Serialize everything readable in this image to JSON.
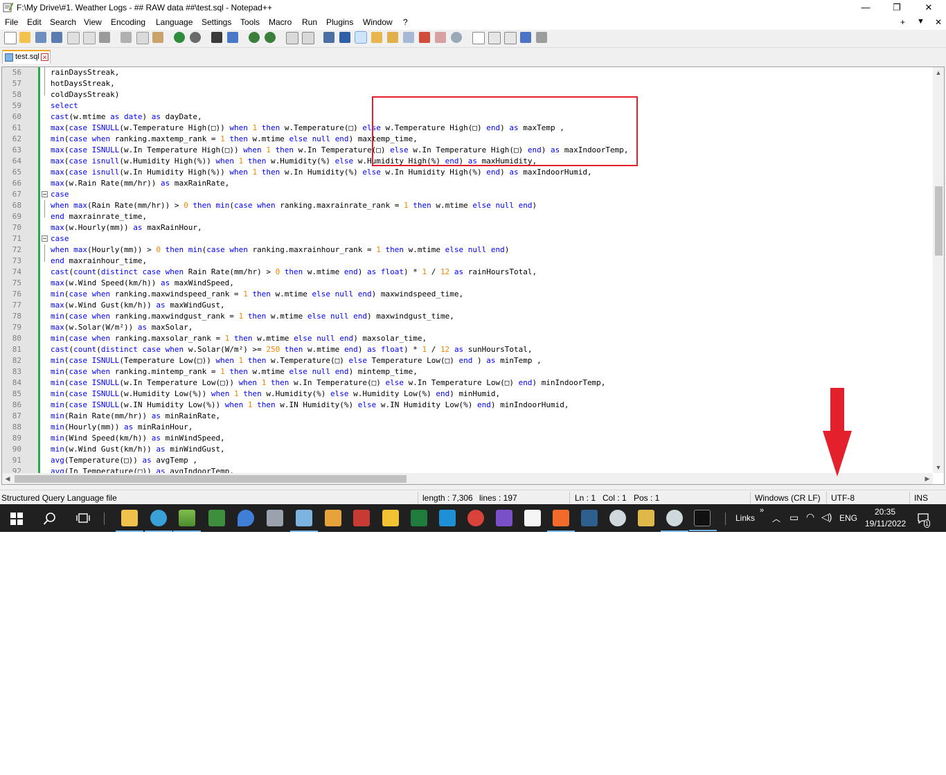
{
  "window": {
    "title": "F:\\My Drive\\#1. Weather Logs - ## RAW data ##\\test.sql - Notepad++",
    "minimize": "—",
    "maximize": "❐",
    "close": "✕"
  },
  "menu": {
    "items": [
      "File",
      "Edit",
      "Search",
      "View",
      "Encoding",
      "Language",
      "Settings",
      "Tools",
      "Macro",
      "Run",
      "Plugins",
      "Window",
      "?"
    ],
    "right": [
      "+",
      "▼",
      "✕"
    ]
  },
  "toolbar": {
    "buttons": [
      "new-file",
      "open-file",
      "save",
      "save-all",
      "close",
      "close-all",
      "print",
      "cut",
      "copy",
      "paste",
      "undo",
      "redo",
      "find",
      "replace",
      "zoom-in",
      "zoom-out",
      "sync-vertical",
      "sync-horizontal",
      "word-wrap",
      "show-all-characters",
      "indent-guide",
      "user-language",
      "document-map",
      "function-list",
      "folder-as-workspace",
      "monitoring",
      "record-macro",
      "stop-recording",
      "playback",
      "run-macro-multiple",
      "save-macro"
    ]
  },
  "tabs": [
    {
      "label": "test.sql",
      "close": "✕"
    }
  ],
  "editor": {
    "lines": [
      {
        "n": "56",
        "t": "rainDaysStreak,"
      },
      {
        "n": "57",
        "t": "hotDaysStreak,"
      },
      {
        "n": "58",
        "t": "coldDaysStreak)"
      },
      {
        "n": "59",
        "t": "select"
      },
      {
        "n": "60",
        "t": "cast(w.mtime as date) as dayDate,"
      },
      {
        "n": "61",
        "t": "max(case ISNULL(w.Temperature High(□)) when 1 then w.Temperature(□) else w.Temperature High(□) end) as maxTemp ,"
      },
      {
        "n": "62",
        "t": "min(case when ranking.maxtemp_rank = 1 then w.mtime else null end) maxtemp_time,"
      },
      {
        "n": "63",
        "t": "max(case ISNULL(w.In Temperature High(□)) when 1 then w.In Temperature(□) else w.In Temperature High(□) end) as maxIndoorTemp,"
      },
      {
        "n": "64",
        "t": "max(case isnull(w.Humidity High(%)) when 1 then w.Humidity(%) else w.Humidity High(%) end) as maxHumidity,"
      },
      {
        "n": "65",
        "t": "max(case isnull(w.In Humidity High(%)) when 1 then w.In Humidity(%) else w.In Humidity High(%) end) as maxIndoorHumid,"
      },
      {
        "n": "66",
        "t": "max(w.Rain Rate(mm/hr)) as maxRainRate,"
      },
      {
        "n": "67",
        "t": "case"
      },
      {
        "n": "68",
        "t": "when max(Rain Rate(mm/hr)) > 0 then min(case when ranking.maxrainrate_rank = 1 then w.mtime else null end)"
      },
      {
        "n": "69",
        "t": "end maxrainrate_time,"
      },
      {
        "n": "70",
        "t": "max(w.Hourly(mm)) as maxRainHour,"
      },
      {
        "n": "71",
        "t": "case"
      },
      {
        "n": "72",
        "t": "when max(Hourly(mm)) > 0 then min(case when ranking.maxrainhour_rank = 1 then w.mtime else null end)"
      },
      {
        "n": "73",
        "t": "end maxrainhour_time,"
      },
      {
        "n": "74",
        "t": "cast(count(distinct case when Rain Rate(mm/hr) > 0 then w.mtime end) as float) * 1 / 12 as rainHoursTotal,"
      },
      {
        "n": "75",
        "t": "max(w.Wind Speed(km/h)) as maxWindSpeed,"
      },
      {
        "n": "76",
        "t": "min(case when ranking.maxwindspeed_rank = 1 then w.mtime else null end) maxwindspeed_time,"
      },
      {
        "n": "77",
        "t": "max(w.Wind Gust(km/h)) as maxWindGust,"
      },
      {
        "n": "78",
        "t": "min(case when ranking.maxwindgust_rank = 1 then w.mtime else null end) maxwindgust_time,"
      },
      {
        "n": "79",
        "t": "max(w.Solar(W/m²)) as maxSolar,"
      },
      {
        "n": "80",
        "t": "min(case when ranking.maxsolar_rank = 1 then w.mtime else null end) maxsolar_time,"
      },
      {
        "n": "81",
        "t": "cast(count(distinct case when w.Solar(W/m²) >= 250 then w.mtime end) as float) * 1 / 12 as sunHoursTotal,"
      },
      {
        "n": "82",
        "t": "min(case ISNULL(Temperature Low(□)) when 1 then w.Temperature(□) else Temperature Low(□) end ) as minTemp ,"
      },
      {
        "n": "83",
        "t": "min(case when ranking.mintemp_rank = 1 then w.mtime else null end) mintemp_time,"
      },
      {
        "n": "84",
        "t": "min(case ISNULL(w.In Temperature Low(□)) when 1 then w.In Temperature(□) else w.In Temperature Low(□) end) minIndoorTemp,"
      },
      {
        "n": "85",
        "t": "min(case ISNULL(w.Humidity Low(%)) when 1 then w.Humidity(%) else w.Humidity Low(%) end) minHumid,"
      },
      {
        "n": "86",
        "t": "min(case ISNULL(w.IN Humidity Low(%)) when 1 then w.IN Humidity(%) else w.IN Humidity Low(%) end) minIndoorHumid,"
      },
      {
        "n": "87",
        "t": "min(Rain Rate(mm/hr)) as minRainRate,"
      },
      {
        "n": "88",
        "t": "min(Hourly(mm)) as minRainHour,"
      },
      {
        "n": "89",
        "t": "min(Wind Speed(km/h)) as minWindSpeed,"
      },
      {
        "n": "90",
        "t": "min(w.Wind Gust(km/h)) as minWindGust,"
      },
      {
        "n": "91",
        "t": "avg(Temperature(□)) as avgTemp ,"
      },
      {
        "n": "92",
        "t": "avg(In Temperature(□)) as avgIndoorTemp,"
      }
    ],
    "keywords": [
      "select",
      "cast",
      "as",
      "date",
      "max",
      "min",
      "avg",
      "case",
      "ISNULL",
      "isnull",
      "when",
      "then",
      "else",
      "end",
      "null",
      "count",
      "distinct",
      "float"
    ]
  },
  "statusbar": {
    "filetype": "Structured Query Language file",
    "length": "length : 7,306",
    "lines": "lines : 197",
    "ln": "Ln : 1",
    "col": "Col : 1",
    "pos": "Pos : 1",
    "eol": "Windows (CR LF)",
    "encoding": "UTF-8",
    "mode": "INS"
  },
  "taskbar": {
    "links": "Links",
    "chevron": "»",
    "language": "ENG",
    "time": "20:35",
    "date": "19/11/2022",
    "notifications": "1"
  },
  "colors": {
    "keyword": "#0000ff",
    "number": "#ff8000",
    "annotation_red": "#e3202c",
    "change_bar": "#2aa84a",
    "taskbar": "#202020"
  }
}
